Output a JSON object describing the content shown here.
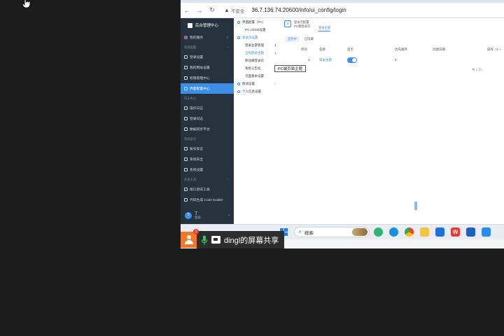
{
  "browser": {
    "security_label": "不安全",
    "url": "36.7.136.74:20600/info/ui_config/login"
  },
  "sidebar": {
    "title": "后台管理中心",
    "items": [
      {
        "label": "我的服务",
        "type": "item",
        "arrow": "›",
        "colored": true
      },
      {
        "label": "系统配置",
        "type": "section",
        "arrow": "›"
      },
      {
        "label": "登录设置",
        "type": "item"
      },
      {
        "label": "我的网站设置",
        "type": "item"
      },
      {
        "label": "权限管理中心",
        "type": "item"
      },
      {
        "label": "界面配置中心",
        "type": "item",
        "active": true
      },
      {
        "label": "日志中心",
        "type": "section"
      },
      {
        "label": "操作日志",
        "type": "item"
      },
      {
        "label": "登录日志",
        "type": "item"
      },
      {
        "label": "数据同步平台",
        "type": "item"
      },
      {
        "label": "系统安全",
        "type": "section"
      },
      {
        "label": "账号安全",
        "type": "item"
      },
      {
        "label": "系统安全",
        "type": "item"
      },
      {
        "label": "系统设置",
        "type": "item"
      },
      {
        "label": "开发工具",
        "type": "section",
        "arrow": "›"
      },
      {
        "label": "接口测试工具",
        "type": "item"
      },
      {
        "label": "代码生成 Code builder",
        "type": "item"
      }
    ],
    "user": {
      "avatar": "?",
      "name": "丁",
      "sub": "超级",
      "arrow": "›"
    }
  },
  "subnav": {
    "items": [
      {
        "label": "界面配置（PC）",
        "style": "dot"
      },
      {
        "label": "PC LOGO设置",
        "style": "indent"
      },
      {
        "label": "登录页设置",
        "style": "blue-dot"
      },
      {
        "label": "登录主题管理",
        "style": "indent",
        "num": "1"
      },
      {
        "label": "全局登录主题",
        "style": "link",
        "num": "1"
      },
      {
        "label": "移动端登录页",
        "style": "indent"
      },
      {
        "label": "系统公告栏",
        "style": "indent"
      },
      {
        "label": "页面基本设置",
        "style": "indent"
      },
      {
        "label": "移动设置",
        "style": "dot",
        "num": "›"
      },
      {
        "label": "个人信息设置",
        "style": "dot"
      }
    ]
  },
  "main": {
    "toolbar_title": "登录页配置",
    "toolbar_sub": "PC端登录页",
    "top_tab": "登录主题",
    "chips": [
      "显示中",
      "已隐藏"
    ],
    "table": {
      "headers": [
        "序号",
        "名称",
        "是否",
        "优先顺序",
        "创建日期",
        "操作（1 »"
      ],
      "row": {
        "index": "1",
        "name": "登录主题",
        "priority": "2"
      }
    },
    "pager": "共 1 页 ›",
    "tooltip": "PC端页面主题"
  },
  "taskbar": {
    "search_placeholder": "搜索"
  },
  "share": {
    "badge": "1",
    "text": "dingl的屏幕共享"
  },
  "colors": {
    "accent": "#3d8ee6",
    "sidebar_bg": "#27323f",
    "share_avatar": "#f0782a"
  }
}
